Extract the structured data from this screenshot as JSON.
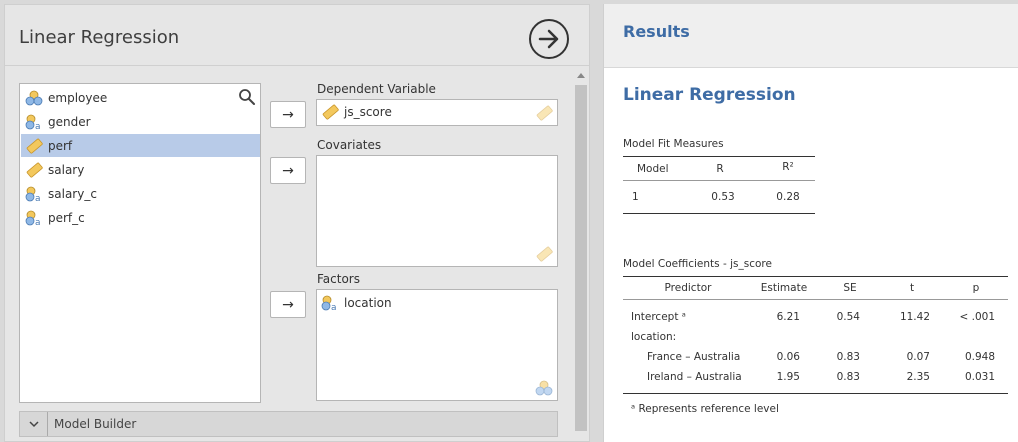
{
  "analysis": {
    "title": "Linear Regression",
    "variables": [
      {
        "name": "employee",
        "icon": "nominal-text-icon"
      },
      {
        "name": "gender",
        "icon": "nominal-text-icon"
      },
      {
        "name": "perf",
        "icon": "continuous-ruler-icon",
        "selected": true
      },
      {
        "name": "salary",
        "icon": "continuous-ruler-icon"
      },
      {
        "name": "salary_c",
        "icon": "nominal-text-icon"
      },
      {
        "name": "perf_c",
        "icon": "nominal-text-icon"
      }
    ],
    "dependent": {
      "label": "Dependent Variable",
      "value": "js_score"
    },
    "covariates": {
      "label": "Covariates"
    },
    "factors": {
      "label": "Factors",
      "value": "location"
    },
    "model_builder": "Model Builder"
  },
  "results": {
    "header": "Results",
    "title": "Linear Regression",
    "fit": {
      "caption": "Model Fit Measures",
      "headers": [
        "Model",
        "R",
        "R²"
      ],
      "rows": [
        [
          "1",
          "0.53",
          "0.28"
        ]
      ]
    },
    "coef": {
      "caption": "Model Coefficients - js_score",
      "headers": [
        "Predictor",
        "Estimate",
        "SE",
        "t",
        "p"
      ],
      "rows": [
        [
          "Intercept ᵃ",
          "6.21",
          "0.54",
          "11.42",
          "< .001"
        ],
        [
          "location:",
          "",
          "",
          "",
          ""
        ],
        [
          "France – Australia",
          "0.06",
          "0.83",
          "0.07",
          "0.948"
        ],
        [
          "Ireland – Australia",
          "1.95",
          "0.83",
          "2.35",
          "0.031"
        ]
      ],
      "footnote": "ᵃ Represents reference level"
    }
  },
  "colors": {
    "accent": "#3e6ca5",
    "selected": "#b8cbe8",
    "ruler": "#f0b94b"
  }
}
